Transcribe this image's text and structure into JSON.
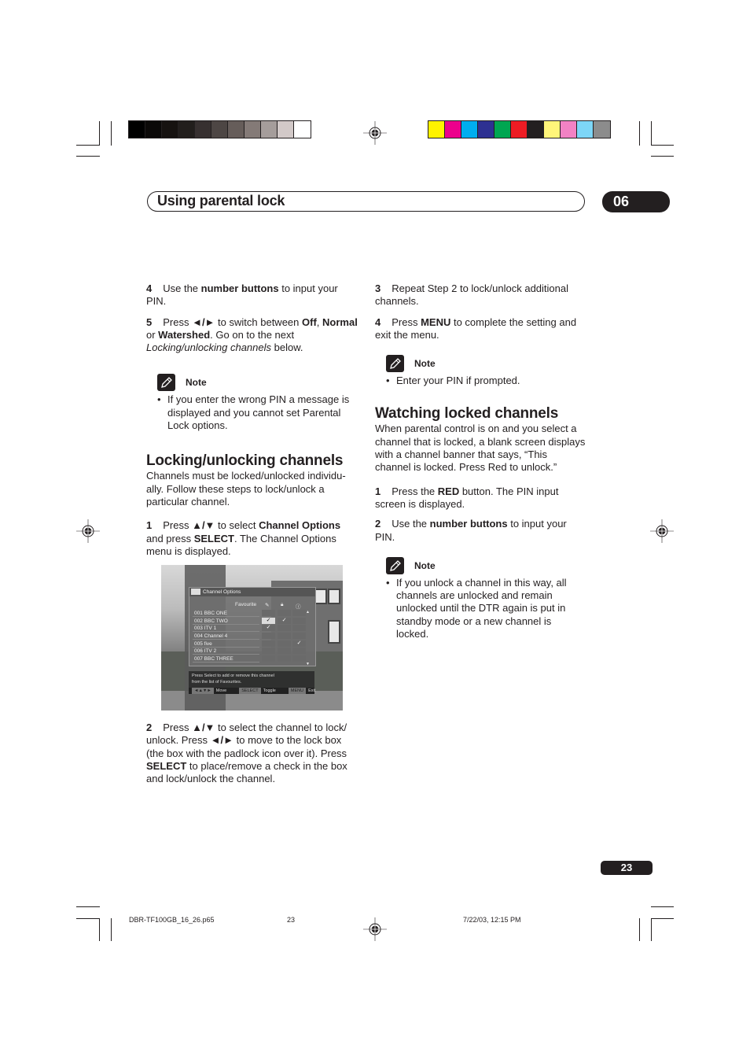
{
  "print_marks": {
    "grayscale_swatches": [
      "#000000",
      "#0b0908",
      "#161210",
      "#221e1c",
      "#373030",
      "#4d4644",
      "#665d5a",
      "#847a77",
      "#a59d9b",
      "#d2c9c8",
      "#ffffff"
    ],
    "color_swatches": [
      "#fff200",
      "#ec008c",
      "#00aeef",
      "#2e3192",
      "#00a651",
      "#ed1c24",
      "#231f20",
      "#fff57a",
      "#f282c4",
      "#7dd6f7",
      "#8c8c8c"
    ],
    "registration_mark_icon": "crosshair-target-icon"
  },
  "header": {
    "title": "Using parental lock",
    "chapter": "06"
  },
  "left_column": {
    "step4": {
      "num": "4",
      "pre": "Use the ",
      "bold": "number buttons",
      "post": " to input your PIN."
    },
    "step5": {
      "num": "5",
      "pre": "Press ",
      "arrows": "◄/►",
      "mid1": " to switch between ",
      "b1": "Off",
      "c1": ",",
      "b2": "Normal",
      "mid2": " or ",
      "b3": "Watershed",
      "mid3": ". Go on to the next ",
      "italic": "Locking/unlocking channels",
      "post": " below."
    },
    "note1": {
      "label": "Note",
      "bullet": "If you enter the wrong PIN a message is displayed and you cannot set Parental Lock options."
    },
    "section_heading": "Locking/unlocking channels",
    "section_intro": "Channels must be locked/unlocked individu-ally. Follow these steps to lock/unlock a particular channel.",
    "step1": {
      "num": "1",
      "pre": "Press ",
      "arrows": "▲/▼",
      "mid1": " to select ",
      "b1": "Channel Options",
      "mid2": " and press ",
      "b2": "SELECT",
      "post": ". The Channel Options menu is displayed."
    },
    "step2": {
      "num": "2",
      "pre": "Press ",
      "arrows1": "▲/▼",
      "mid1": " to select the channel to lock/ unlock. Press ",
      "arrows2": "◄/►",
      "mid2": " to move to the lock box (the box with the padlock icon over it). Press ",
      "b1": "SELECT",
      "post": " to place/remove a check in the box and lock/unlock the channel."
    }
  },
  "screenshot": {
    "title": "Channel Options",
    "column_header": "Favourite",
    "column_icons": [
      "pencil-icon",
      "padlock-icon",
      "info-icon"
    ],
    "check_glyph": "✓",
    "scroll_up": "▲",
    "scroll_down": "▼",
    "channels": [
      {
        "name": "001 BBC ONE",
        "fav": false,
        "edit": false,
        "lock": false,
        "info": false
      },
      {
        "name": "002 BBC TWO",
        "fav": false,
        "edit": true,
        "lock": true,
        "info": false
      },
      {
        "name": "003 ITV 1",
        "fav": false,
        "edit": true,
        "lock": false,
        "info": false
      },
      {
        "name": "004 Channel 4",
        "fav": false,
        "edit": false,
        "lock": false,
        "info": false
      },
      {
        "name": "005 five",
        "fav": false,
        "edit": false,
        "lock": false,
        "info": true
      },
      {
        "name": "006 ITV 2",
        "fav": false,
        "edit": false,
        "lock": false,
        "info": false
      },
      {
        "name": "007 BBC THREE",
        "fav": false,
        "edit": false,
        "lock": false,
        "info": false
      }
    ],
    "help_line1": "Press Select to add or remove this channel",
    "help_line2": "from the list of Favourites.",
    "keys": [
      {
        "key": "◄▲▼►",
        "label": "Move"
      },
      {
        "key": "SELECT",
        "label": "Toggle"
      },
      {
        "key": "MENU",
        "label": "Exit"
      }
    ]
  },
  "right_column": {
    "step3": {
      "num": "3",
      "text": "Repeat Step 2 to lock/unlock additional channels."
    },
    "step4": {
      "num": "4",
      "pre": "Press ",
      "bold": "MENU",
      "post": " to complete the setting and exit the menu."
    },
    "note2": {
      "label": "Note",
      "bullet": "Enter your PIN if prompted."
    },
    "section_heading": "Watching locked channels",
    "section_intro": "When parental control is on and you select a channel that is locked, a blank screen displays with a channel banner that says, “This channel is locked. Press Red to unlock.”",
    "step1": {
      "num": "1",
      "pre": "Press the ",
      "bold": "RED",
      "post": " button. The PIN input screen is displayed."
    },
    "step2": {
      "num": "2",
      "pre": "Use the ",
      "bold": "number buttons",
      "post": " to input your PIN."
    },
    "note3": {
      "label": "Note",
      "bullet": "If you unlock a channel in this way, all channels are unlocked and remain unlocked until the DTR again is put in standby mode or a new channel is locked."
    }
  },
  "footer": {
    "page_number": "23",
    "slug_file": "DBR-TF100GB_16_26.p65",
    "slug_page": "23",
    "slug_date": "7/22/03, 12:15 PM"
  }
}
